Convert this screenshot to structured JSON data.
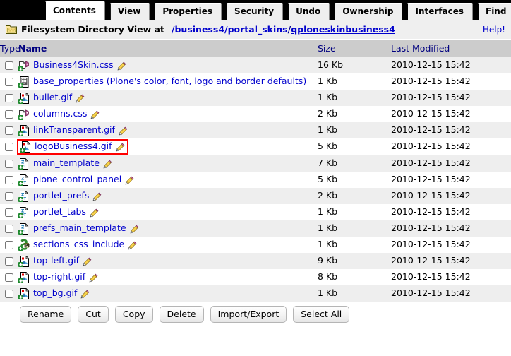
{
  "tabs": [
    {
      "label": "Contents",
      "selected": true
    },
    {
      "label": "View",
      "selected": false
    },
    {
      "label": "Properties",
      "selected": false
    },
    {
      "label": "Security",
      "selected": false
    },
    {
      "label": "Undo",
      "selected": false
    },
    {
      "label": "Ownership",
      "selected": false
    },
    {
      "label": "Interfaces",
      "selected": false
    },
    {
      "label": "Find",
      "selected": false
    }
  ],
  "header": {
    "icon": "folder-icon",
    "title": "Filesystem Directory View at",
    "path_segments": [
      {
        "text": "/business4",
        "underline": false
      },
      {
        "text": "/portal_skins",
        "underline": false
      },
      {
        "text": "/",
        "underline": false,
        "separator": true
      },
      {
        "text": "qploneskinbusiness4",
        "underline": true
      }
    ],
    "path_full": "/business4/portal_skins/qploneskinbusiness4",
    "help_label": "Help!"
  },
  "table": {
    "columns": [
      {
        "key": "type",
        "label": "Type",
        "sorted": false
      },
      {
        "key": "name",
        "label": "Name",
        "sorted": true
      },
      {
        "key": "size",
        "label": "Size",
        "sorted": false
      },
      {
        "key": "date",
        "label": "Last Modified",
        "sorted": false
      }
    ],
    "rows": [
      {
        "icon": "css-file-icon",
        "name": "Business4Skin.css",
        "size": "16 Kb",
        "date": "2010-12-15 15:42",
        "checked": false,
        "highlighted": false,
        "editable": true
      },
      {
        "icon": "properties-file-icon",
        "name": "base_properties (Plone's color, font, logo and border defaults)",
        "size": "1 Kb",
        "date": "2010-12-15 15:42",
        "checked": false,
        "highlighted": false,
        "editable": false
      },
      {
        "icon": "image-file-icon",
        "name": "bullet.gif",
        "size": "1 Kb",
        "date": "2010-12-15 15:42",
        "checked": false,
        "highlighted": false,
        "editable": true
      },
      {
        "icon": "css-file-icon",
        "name": "columns.css",
        "size": "2 Kb",
        "date": "2010-12-15 15:42",
        "checked": false,
        "highlighted": false,
        "editable": true
      },
      {
        "icon": "image-file-icon",
        "name": "linkTransparent.gif",
        "size": "1 Kb",
        "date": "2010-12-15 15:42",
        "checked": false,
        "highlighted": false,
        "editable": true
      },
      {
        "icon": "image-file-icon",
        "name": "logoBusiness4.gif",
        "size": "5 Kb",
        "date": "2010-12-15 15:42",
        "checked": false,
        "highlighted": true,
        "editable": true
      },
      {
        "icon": "template-file-icon",
        "name": "main_template",
        "size": "7 Kb",
        "date": "2010-12-15 15:42",
        "checked": false,
        "highlighted": false,
        "editable": true
      },
      {
        "icon": "template-file-icon",
        "name": "plone_control_panel",
        "size": "5 Kb",
        "date": "2010-12-15 15:42",
        "checked": false,
        "highlighted": false,
        "editable": true
      },
      {
        "icon": "template-file-icon",
        "name": "portlet_prefs",
        "size": "2 Kb",
        "date": "2010-12-15 15:42",
        "checked": false,
        "highlighted": false,
        "editable": true
      },
      {
        "icon": "template-file-icon",
        "name": "portlet_tabs",
        "size": "1 Kb",
        "date": "2010-12-15 15:42",
        "checked": false,
        "highlighted": false,
        "editable": true
      },
      {
        "icon": "template-file-icon",
        "name": "prefs_main_template",
        "size": "1 Kb",
        "date": "2010-12-15 15:42",
        "checked": false,
        "highlighted": false,
        "editable": true
      },
      {
        "icon": "python-script-icon",
        "name": "sections_css_include",
        "size": "1 Kb",
        "date": "2010-12-15 15:42",
        "checked": false,
        "highlighted": false,
        "editable": true
      },
      {
        "icon": "image-file-icon",
        "name": "top-left.gif",
        "size": "9 Kb",
        "date": "2010-12-15 15:42",
        "checked": false,
        "highlighted": false,
        "editable": true
      },
      {
        "icon": "image-file-icon",
        "name": "top-right.gif",
        "size": "8 Kb",
        "date": "2010-12-15 15:42",
        "checked": false,
        "highlighted": false,
        "editable": true
      },
      {
        "icon": "image-file-icon",
        "name": "top_bg.gif",
        "size": "1 Kb",
        "date": "2010-12-15 15:42",
        "checked": false,
        "highlighted": false,
        "editable": true
      }
    ]
  },
  "buttons": [
    {
      "label": "Rename"
    },
    {
      "label": "Cut"
    },
    {
      "label": "Copy"
    },
    {
      "label": "Delete"
    },
    {
      "label": "Import/Export"
    },
    {
      "label": "Select All"
    }
  ],
  "colors": {
    "tabbar_background": "#000000",
    "tab_background": "#efefef",
    "tab_selected_background": "#ffffff",
    "header_background": "#efefef",
    "table_header_background": "#cccccc",
    "table_header_text": "#00007f",
    "link": "#0000cc",
    "row_odd": "#eeeeee",
    "row_even": "#ffffff",
    "highlight_border": "#ff0000"
  }
}
